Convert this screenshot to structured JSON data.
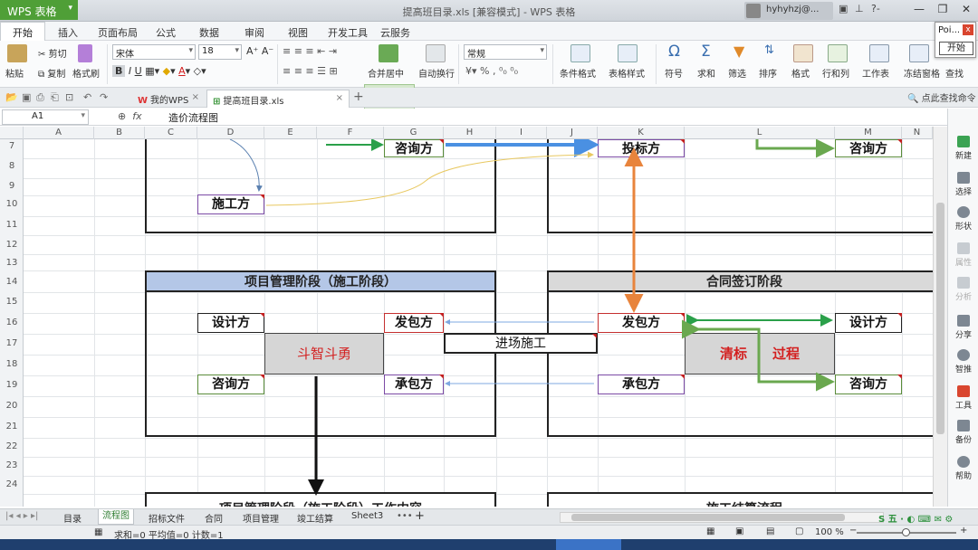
{
  "titlebar": {
    "app_name": "WPS 表格",
    "doc_title": "提高班目录.xls [兼容模式] - WPS 表格",
    "user": "hyhyhzj@..."
  },
  "menus": [
    "开始",
    "插入",
    "页面布局",
    "公式",
    "数据",
    "审阅",
    "视图",
    "开发工具",
    "云服务"
  ],
  "ribbon": {
    "paste": "粘贴",
    "cut": "剪切",
    "copy": "复制",
    "format_painter": "格式刷",
    "font_name": "宋体",
    "font_size": "18",
    "merge_center": "合并居中",
    "wrap": "自动换行",
    "number_format": "常规",
    "cond_format": "条件格式",
    "table_style": "表格样式",
    "symbol": "符号",
    "sum": "求和",
    "filter": "筛选",
    "sort": "排序",
    "format": "格式",
    "rows_cols": "行和列",
    "worksheet": "工作表",
    "freeze": "冻结窗格",
    "find": "查找"
  },
  "popup": {
    "title": "Poi...",
    "button": "开始"
  },
  "doc_tabs": [
    {
      "label": "我的WPS"
    },
    {
      "label": "提高班目录.xls"
    }
  ],
  "search_cmd": "点此查找命令",
  "formula": {
    "cell": "A1",
    "fx": "fx",
    "content": "造价流程图"
  },
  "columns": [
    "A",
    "B",
    "C",
    "D",
    "E",
    "F",
    "G",
    "H",
    "I",
    "J",
    "K",
    "L",
    "M",
    "N"
  ],
  "rows": [
    "7",
    "8",
    "9",
    "10",
    "11",
    "12",
    "13",
    "14",
    "15",
    "16",
    "17",
    "18",
    "19",
    "20",
    "21",
    "22",
    "23",
    "24"
  ],
  "diagram": {
    "top_consult_left": "咨询方",
    "top_bidder": "投标方",
    "top_consult_right": "咨询方",
    "constructor": "施工方",
    "phase_left": "项目管理阶段（施工阶段）",
    "phase_right": "合同签订阶段",
    "design_left": "设计方",
    "employer_left": "发包方",
    "employer_right": "发包方",
    "design_right": "设计方",
    "entry": "进场施工",
    "struggle": "斗智斗勇",
    "clear_bid": "清标",
    "process": "过程",
    "consult_left": "咨询方",
    "contractor_left": "承包方",
    "contractor_right": "承包方",
    "consult_right": "咨询方",
    "bottom_left": "项目管理阶段（施工阶段）工作内容",
    "bottom_right": "施工结算流程"
  },
  "right_panel": [
    "新建",
    "选择",
    "形状",
    "属性",
    "分析",
    "分享",
    "智推",
    "工具",
    "备份",
    "帮助"
  ],
  "sheet_tabs": [
    "目录",
    "流程图",
    "招标文件",
    "合同",
    "项目管理",
    "竣工结算",
    "Sheet3"
  ],
  "status": {
    "text": "求和=0  平均值=0  计数=1",
    "zoom": "100 %"
  },
  "colors": {
    "wps_green": "#4f9f37",
    "header_blue": "#b4c7e7",
    "header_gray": "#d9d9d9",
    "arrow_blue": "#4a90e2",
    "arrow_orange": "#e8843c",
    "arrow_green": "#6aa84f",
    "arrow_red": "#d32020"
  }
}
